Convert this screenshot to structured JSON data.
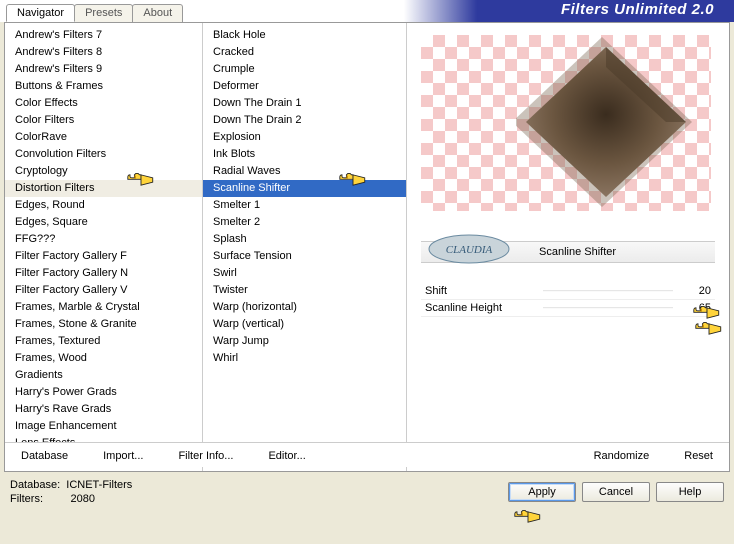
{
  "header": {
    "title": "Filters Unlimited 2.0"
  },
  "tabs": [
    {
      "label": "Navigator",
      "active": true
    },
    {
      "label": "Presets",
      "active": false
    },
    {
      "label": "About",
      "active": false
    }
  ],
  "categories": [
    "Andrew's Filters 7",
    "Andrew's Filters 8",
    "Andrew's Filters 9",
    "Buttons & Frames",
    "Color Effects",
    "Color Filters",
    "ColorRave",
    "Convolution Filters",
    "Cryptology",
    "Distortion Filters",
    "Edges, Round",
    "Edges, Square",
    "FFG???",
    "Filter Factory Gallery F",
    "Filter Factory Gallery N",
    "Filter Factory Gallery V",
    "Frames, Marble & Crystal",
    "Frames, Stone & Granite",
    "Frames, Textured",
    "Frames, Wood",
    "Gradients",
    "Harry's Power Grads",
    "Harry's Rave Grads",
    "Image Enhancement",
    "Lens Effects"
  ],
  "categories_selected_index": 9,
  "filters": [
    "Black Hole",
    "Cracked",
    "Crumple",
    "Deformer",
    "Down The Drain 1",
    "Down The Drain 2",
    "Explosion",
    "Ink Blots",
    "Radial Waves",
    "Scanline Shifter",
    "Smelter 1",
    "Smelter 2",
    "Splash",
    "Surface Tension",
    "Swirl",
    "Twister",
    "Warp (horizontal)",
    "Warp (vertical)",
    "Warp Jump",
    "Whirl"
  ],
  "filters_selected_index": 9,
  "current_filter": {
    "name": "Scanline Shifter"
  },
  "params": [
    {
      "label": "Shift",
      "value": 20
    },
    {
      "label": "Scanline Height",
      "value": 65
    }
  ],
  "buttons": {
    "database": "Database",
    "import": "Import...",
    "filter_info": "Filter Info...",
    "editor": "Editor...",
    "randomize": "Randomize",
    "reset": "Reset",
    "apply": "Apply",
    "cancel": "Cancel",
    "help": "Help"
  },
  "footer": {
    "database_label": "Database:",
    "database_value": "ICNET-Filters",
    "filters_label": "Filters:",
    "filters_value": "2080"
  },
  "watermark_text": "CLAUDIA"
}
